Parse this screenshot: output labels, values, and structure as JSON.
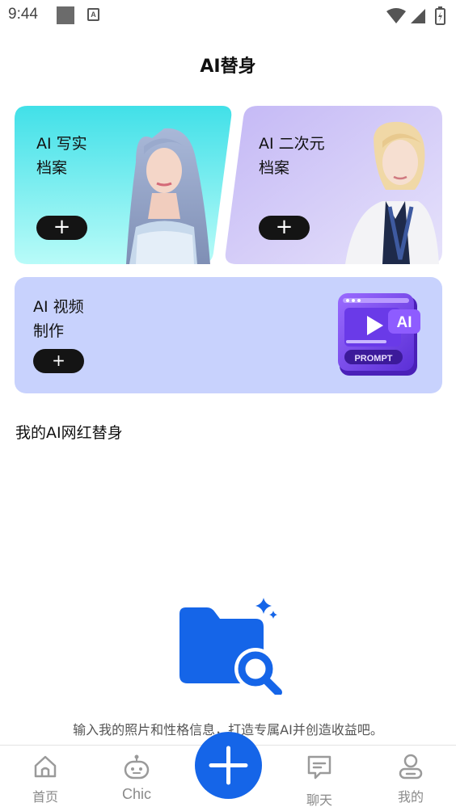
{
  "status_bar": {
    "time": "9:44",
    "icons": [
      "notification-square-icon",
      "a-app-icon",
      "wifi-icon",
      "signal-icon",
      "battery-charging-icon"
    ]
  },
  "header": {
    "title": "AI替身"
  },
  "cards": {
    "realistic": {
      "title": "AI 写实\n档案",
      "button": "+",
      "colors": [
        "#41e0e8",
        "#b8fbf8"
      ]
    },
    "anime": {
      "title": "AI 二次元\n档案",
      "button": "+",
      "colors": [
        "#c4b8f5",
        "#e6e2fb"
      ]
    },
    "video": {
      "title": "AI 视频\n制作",
      "button": "+",
      "badge_ai": "AI",
      "badge_prompt": "PROMPT",
      "color": "#c8d2fd"
    }
  },
  "section": {
    "title": "我的AI网红替身"
  },
  "empty_state": {
    "icon": "folder-search-icon",
    "text": "输入我的照片和性格信息，打造专属AI并创造收益吧。"
  },
  "tab_bar": {
    "items": [
      {
        "label": "首页",
        "icon": "home-icon"
      },
      {
        "label": "Chic",
        "icon": "robot-icon"
      },
      {
        "label": "聊天",
        "icon": "chat-icon"
      },
      {
        "label": "我的",
        "icon": "profile-icon"
      }
    ],
    "center_button": {
      "icon": "plus-icon",
      "color": "#1565e8"
    }
  }
}
